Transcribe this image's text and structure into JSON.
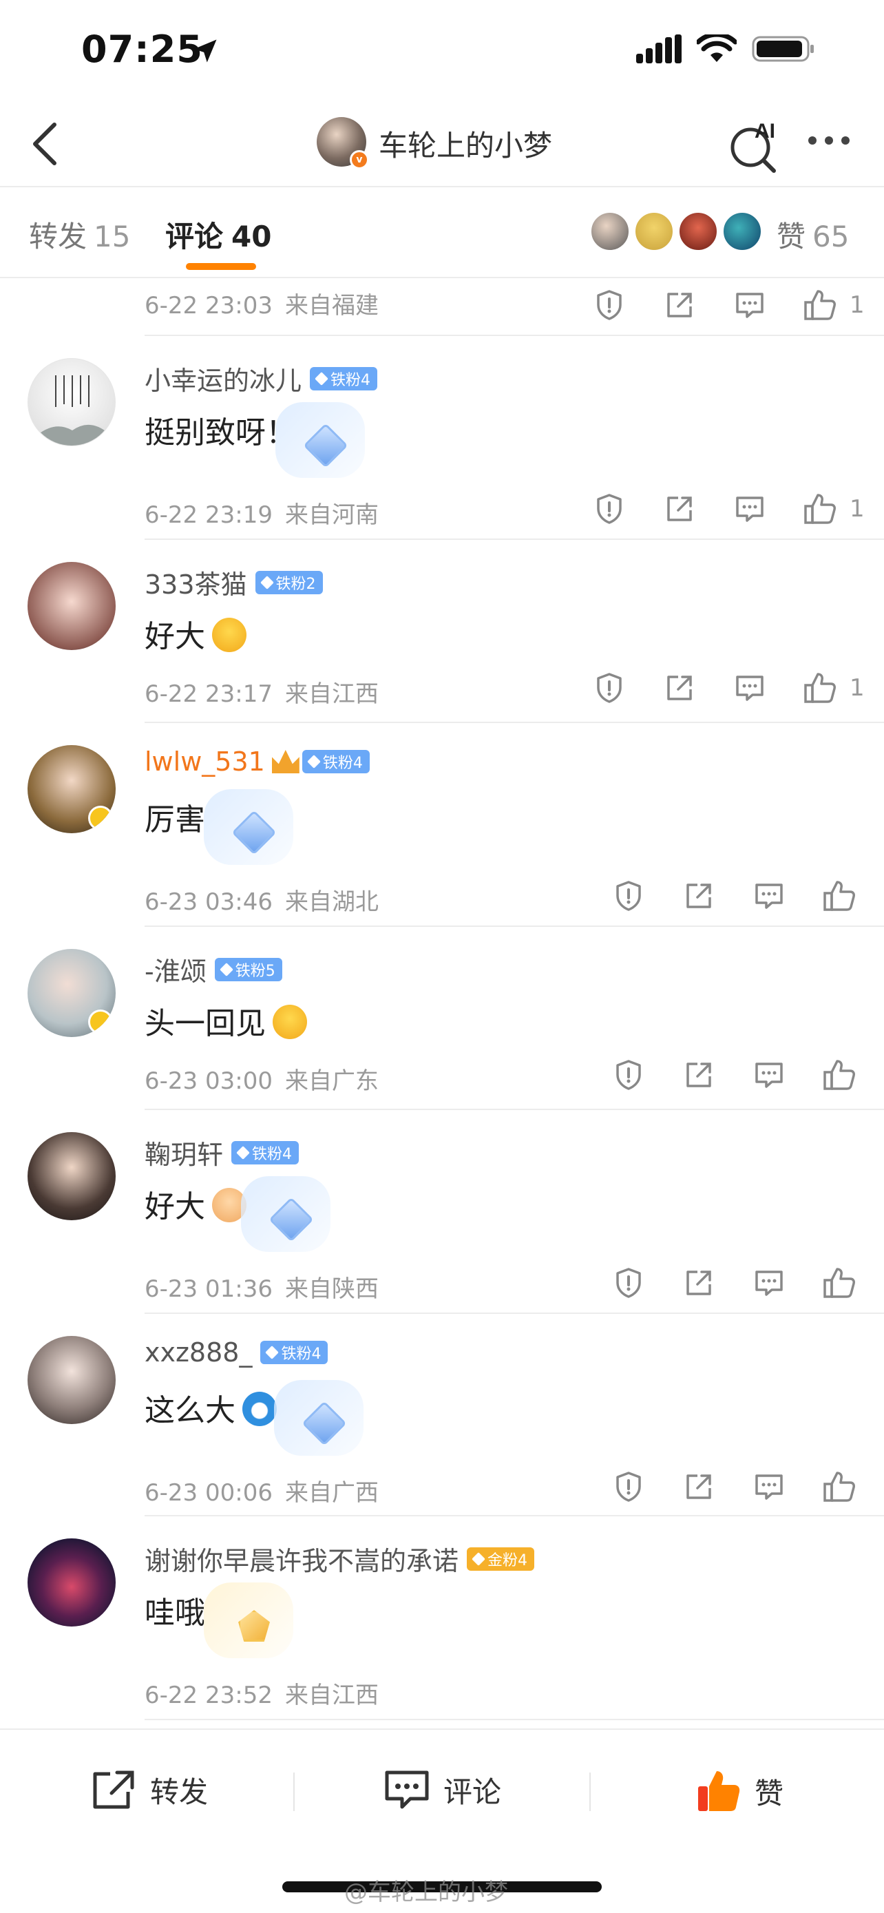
{
  "status_bar": {
    "time": "07:25"
  },
  "nav": {
    "title": "车轮上的小梦",
    "ai_label": "AI"
  },
  "tabs": {
    "repost_label": "转发",
    "repost_count": "15",
    "comment_label": "评论",
    "comment_count": "40",
    "like_label": "赞",
    "like_count": "65"
  },
  "top_partial": {
    "time": "6-22 23:03",
    "location": "来自福建",
    "likes": "1"
  },
  "comments": [
    {
      "username": "小幸运的冰儿",
      "badge": "铁粉4",
      "text": "挺别致呀！",
      "time": "6-22 23:19",
      "location": "来自河南",
      "likes": "1"
    },
    {
      "username": "333茶猫",
      "badge": "铁粉2",
      "text": "好大",
      "time": "6-22 23:17",
      "location": "来自江西",
      "likes": "1"
    },
    {
      "username": "lwlw_531",
      "badge": "铁粉4",
      "text": "厉害",
      "time": "6-23 03:46",
      "location": "来自湖北",
      "likes": ""
    },
    {
      "username": "-淮颂",
      "badge": "铁粉5",
      "text": "头一回见",
      "time": "6-23 03:00",
      "location": "来自广东",
      "likes": ""
    },
    {
      "username": "鞠玥轩",
      "badge": "铁粉4",
      "text": "好大",
      "time": "6-23 01:36",
      "location": "来自陕西",
      "likes": ""
    },
    {
      "username": "xxz888_",
      "badge": "铁粉4",
      "text": "这么大",
      "time": "6-23 00:06",
      "location": "来自广西",
      "likes": ""
    },
    {
      "username": "谢谢你早晨许我不嵩的承诺",
      "badge": "金粉4",
      "text": "哇哦",
      "time": "6-22 23:52",
      "location": "来自江西",
      "likes": ""
    }
  ],
  "toolbar": {
    "repost": "转发",
    "comment": "评论",
    "like": "赞"
  },
  "watermark": "@车轮上的小梦",
  "colors": {
    "accent": "#ff8200",
    "badge_blue": "#6aa8f7",
    "badge_gold": "#f6b02a",
    "username_orange": "#f2761b"
  }
}
